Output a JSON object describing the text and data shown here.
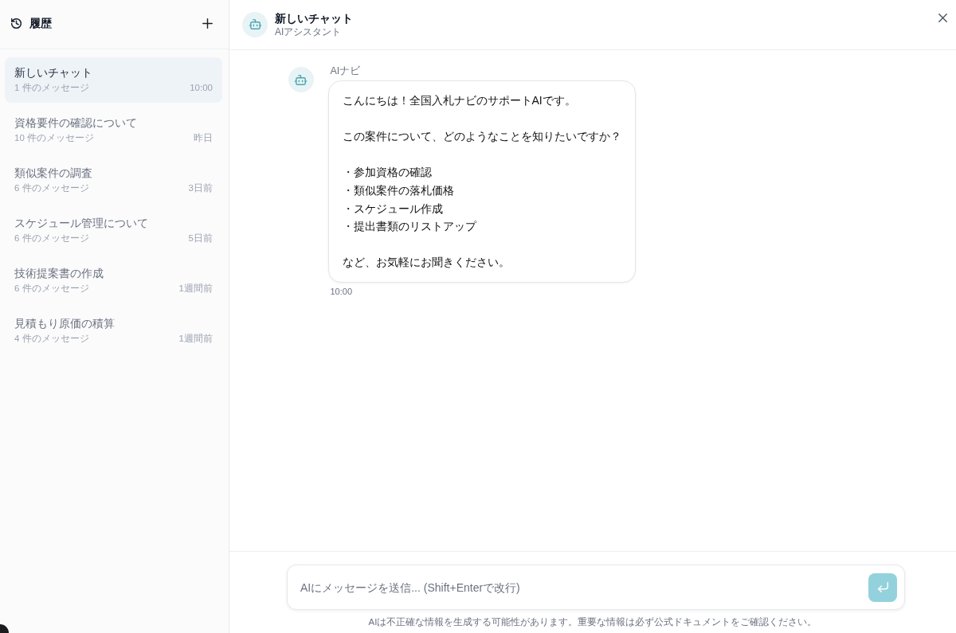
{
  "sidebar": {
    "title": "履歴",
    "items": [
      {
        "title": "新しいチャット",
        "meta": "1 件のメッセージ",
        "time": "10:00",
        "selected": true
      },
      {
        "title": "資格要件の確認について",
        "meta": "10 件のメッセージ",
        "time": "昨日",
        "selected": false
      },
      {
        "title": "類似案件の調査",
        "meta": "6 件のメッセージ",
        "time": "3日前",
        "selected": false
      },
      {
        "title": "スケジュール管理について",
        "meta": "6 件のメッセージ",
        "time": "5日前",
        "selected": false
      },
      {
        "title": "技術提案書の作成",
        "meta": "6 件のメッセージ",
        "time": "1週間前",
        "selected": false
      },
      {
        "title": "見積もり原価の積算",
        "meta": "4 件のメッセージ",
        "time": "1週間前",
        "selected": false
      }
    ]
  },
  "header": {
    "title": "新しいチャット",
    "subtitle": "AIアシスタント"
  },
  "messages": [
    {
      "sender": "AIナビ",
      "blocks": [
        {
          "kind": "paragraph",
          "text": "こんにちは！全国入札ナビのサポートAIです。"
        },
        {
          "kind": "paragraph",
          "text": "この案件について、どのようなことを知りたいですか？"
        },
        {
          "kind": "list",
          "items": [
            "・参加資格の確認",
            "・類似案件の落札価格",
            "・スケジュール作成",
            "・提出書類のリストアップ"
          ]
        },
        {
          "kind": "paragraph",
          "text": "など、お気軽にお聞きください。"
        }
      ],
      "time": "10:00"
    }
  ],
  "composer": {
    "placeholder": "AIにメッセージを送信... (Shift+Enterで改行)",
    "send_disabled": true
  },
  "disclaimer": "AIは不正確な情報を生成する可能性があります。重要な情報は必ず公式ドキュメントをご確認ください。"
}
